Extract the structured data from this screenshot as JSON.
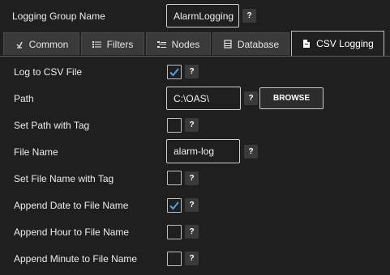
{
  "header": {
    "group_label": "Logging Group Name",
    "group_value": "AlarmLogging",
    "help": "?"
  },
  "tabs": [
    {
      "label": "Common",
      "icon": "chevron-icon",
      "active": false
    },
    {
      "label": "Filters",
      "icon": "list-icon",
      "active": false
    },
    {
      "label": "Nodes",
      "icon": "nodes-icon",
      "active": false
    },
    {
      "label": "Database",
      "icon": "database-icon",
      "active": false
    },
    {
      "label": "CSV Logging",
      "icon": "file-icon",
      "active": true
    }
  ],
  "form": {
    "log_to_csv": {
      "label": "Log to CSV File",
      "checked": true
    },
    "path": {
      "label": "Path",
      "value": "C:\\OAS\\",
      "button": "BROWSE"
    },
    "set_path_with_tag": {
      "label": "Set Path with Tag",
      "checked": false
    },
    "file_name": {
      "label": "File Name",
      "value": "alarm-log"
    },
    "set_file_name_with_tag": {
      "label": "Set File Name with Tag",
      "checked": false
    },
    "append_date": {
      "label": "Append Date to File Name",
      "checked": true
    },
    "append_hour": {
      "label": "Append Hour to File Name",
      "checked": false
    },
    "append_minute": {
      "label": "Append Minute to File Name",
      "checked": false
    }
  },
  "colors": {
    "background": "#1f1f1f",
    "tab_inactive": "#3a3a3a",
    "checkmark": "#4aa3e0"
  }
}
